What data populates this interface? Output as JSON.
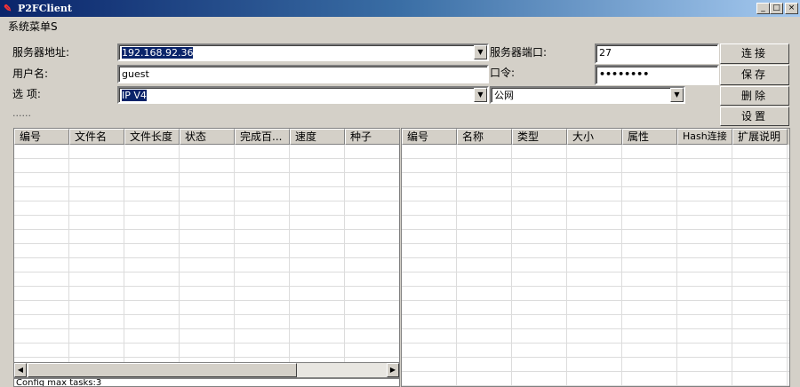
{
  "window": {
    "title": "P2FClient",
    "min": "_",
    "max": "□",
    "close": "×"
  },
  "menu": {
    "system": "系统菜单S"
  },
  "form": {
    "server_label": "服务器地址:",
    "server_value": "192.168.92.36",
    "user_label": "用户名:",
    "user_value": "guest",
    "option_label": "选 项:",
    "option_value": "IP V4",
    "network_value": "公网",
    "port_label": "服务器端口:",
    "port_value": "27",
    "password_label": "口令:",
    "password_value": "••••••••",
    "ellipsis": "......"
  },
  "buttons": {
    "connect": "连接",
    "save": "保存",
    "delete": "删除",
    "settings": "设置"
  },
  "left_table": {
    "columns": [
      "编号",
      "文件名",
      "文件长度",
      "状态",
      "完成百...",
      "速度",
      "种子"
    ]
  },
  "right_table": {
    "columns": [
      "编号",
      "名称",
      "类型",
      "大小",
      "属性",
      "Hash连接",
      "扩展说明"
    ]
  },
  "status": "Config max tasks:3",
  "scroll": {
    "left": "◀",
    "right": "▶"
  }
}
